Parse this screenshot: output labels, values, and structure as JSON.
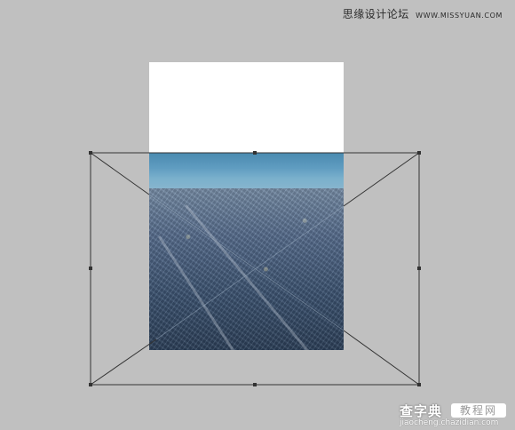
{
  "watermark": {
    "chinese": "思缘设计论坛",
    "site": "WWW.MISSYUAN.COM"
  },
  "footer": {
    "brand": "查字典",
    "tag": "教程网",
    "url": "jiaocheng.chazidian.com"
  },
  "colors": {
    "workspace": "#c0c0c0",
    "canvas": "#ffffff",
    "transform_line": "#333333",
    "handle": "#333333"
  },
  "transform": {
    "mode": "free-transform-bounding-box",
    "handles": 8,
    "has_center_diagonals": true
  }
}
